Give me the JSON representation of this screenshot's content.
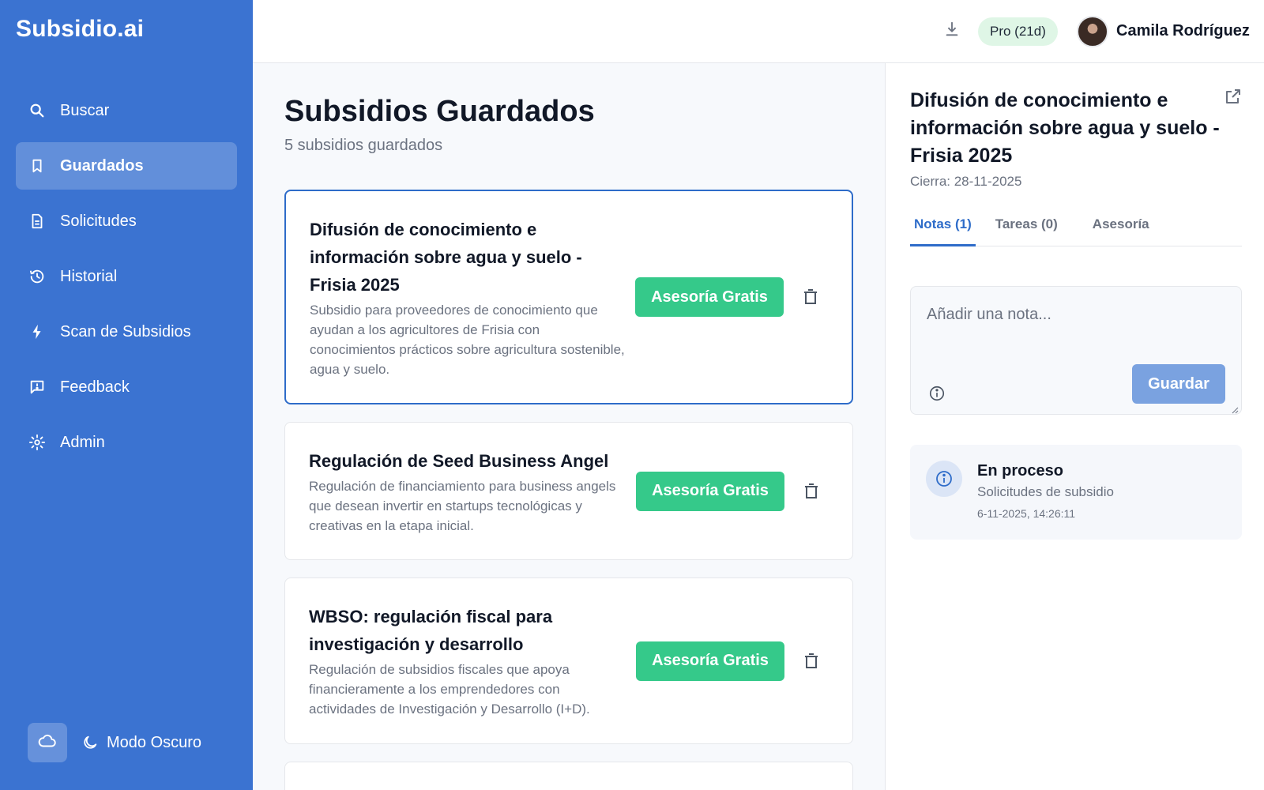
{
  "app": {
    "brand": "Subsidio.ai"
  },
  "sidebar": {
    "items": [
      {
        "label": "Buscar",
        "icon": "search-icon"
      },
      {
        "label": "Guardados",
        "icon": "bookmark-icon",
        "active": true
      },
      {
        "label": "Solicitudes",
        "icon": "document-icon"
      },
      {
        "label": "Historial",
        "icon": "history-icon"
      },
      {
        "label": "Scan de Subsidios",
        "icon": "lightning-icon"
      },
      {
        "label": "Feedback",
        "icon": "feedback-icon"
      },
      {
        "label": "Admin",
        "icon": "gear-icon"
      }
    ],
    "dark_mode_label": "Modo Oscuro"
  },
  "topbar": {
    "plan_badge": "Pro (21d)",
    "user_name": "Camila Rodríguez"
  },
  "main": {
    "title": "Subsidios Guardados",
    "subtitle": "5 subsidios guardados",
    "cards": [
      {
        "title": "Difusión de conocimiento e información sobre agua y suelo - Frisia 2025",
        "description": "Subsidio para proveedores de conocimiento que ayudan a los agricultores de Frisia con conocimientos prácticos sobre agricultura sostenible, agua y suelo.",
        "button_label": "Asesoría Gratis"
      },
      {
        "title": "Regulación de Seed Business Angel",
        "description": "Regulación de financiamiento para business angels que desean invertir en startups tecnológicas y creativas en la etapa inicial.",
        "button_label": "Asesoría Gratis"
      },
      {
        "title": "WBSO: regulación fiscal para investigación y desarrollo",
        "description": "Regulación de subsidios fiscales que apoya financieramente a los emprendedores con actividades de Investigación y Desarrollo (I+D).",
        "button_label": "Asesoría Gratis"
      }
    ]
  },
  "panel": {
    "title": "Difusión de conocimiento e información sobre agua y suelo - Frisia 2025",
    "closing": "Cierra: 28-11-2025",
    "tabs": [
      {
        "label": "Notas (1)",
        "active": true
      },
      {
        "label": "Tareas (0)"
      },
      {
        "label": "Asesoría"
      }
    ],
    "note_placeholder": "Añadir una nota...",
    "save_label": "Guardar",
    "status": {
      "title": "En proceso",
      "subtitle": "Solicitudes de subsidio",
      "timestamp": "6-11-2025, 14:26:11"
    }
  },
  "colors": {
    "sidebar": "#3b73d1",
    "accent": "#2e6cc9",
    "green": "#35c98a",
    "badge": "#dff6e6"
  }
}
